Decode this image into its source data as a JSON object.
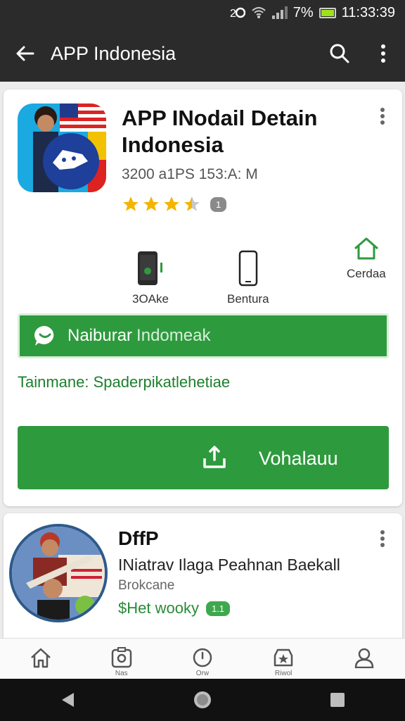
{
  "status_bar": {
    "battery_percent": "7%",
    "time": "11:33:39",
    "icons": [
      "sim-icon",
      "wifi-icon",
      "signal-icon",
      "battery-icon"
    ]
  },
  "app_bar": {
    "title": "APP Indonesia",
    "back_icon": "arrow-left-icon",
    "actions": [
      "search-icon",
      "more-vert-icon"
    ]
  },
  "featured_app": {
    "title": "APP INodail Detain Indonesia",
    "meta": "3200 a1PS 153:A: M",
    "rating": 3.5,
    "rating_badge": "1",
    "features": [
      {
        "label": "3OAke",
        "icon": "phone-icon"
      },
      {
        "label": "Bentura",
        "icon": "smartphone-icon"
      },
      {
        "label": "Cerdaa",
        "icon": "home-outline-icon"
      }
    ],
    "chat_banner": {
      "label": "Naiburar",
      "sub": "Indomeak",
      "icon": "chat-bubble-icon"
    },
    "tagline": "Tainmane: Spaderpikatlehetiae",
    "download_label": "Vohalauu",
    "accent": "#2e9a3e"
  },
  "second_app": {
    "title": "DffP",
    "description": "INiatrav Ilaga  Peahnan Baekall",
    "developer": "Brokcane",
    "price": "$Het wooky",
    "badge": "1.1"
  },
  "bottom_nav": {
    "items": [
      {
        "name": "home",
        "icon": "home-icon",
        "label": ""
      },
      {
        "name": "apps",
        "icon": "apps-icon",
        "label": "Nas"
      },
      {
        "name": "updates",
        "icon": "clock-icon",
        "label": "Orw"
      },
      {
        "name": "rewards",
        "icon": "badge-star-icon",
        "label": "Riwol"
      },
      {
        "name": "account",
        "icon": "person-icon",
        "label": ""
      }
    ]
  }
}
